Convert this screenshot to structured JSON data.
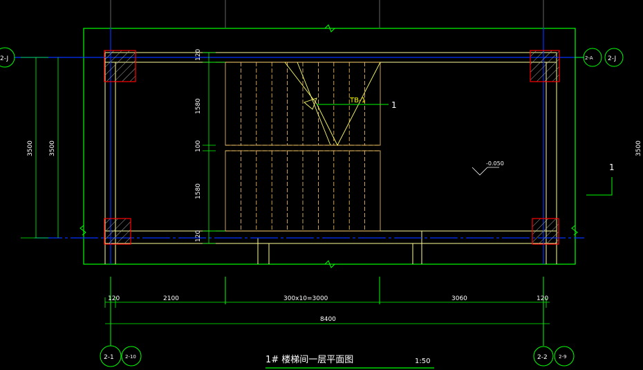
{
  "colors": {
    "background": "#000000",
    "outline": "#00ff00",
    "wall": "#ffff99",
    "axis": "#0000ff",
    "column": "#ff0000",
    "stair": "#ffcc66",
    "text": "#ffffff",
    "note": "#ffff00"
  },
  "axes": {
    "left_top": "2-J",
    "right_a": "2-A",
    "right_j": "2-J",
    "bottom_left_1": "2-1",
    "bottom_left_2": "2-10",
    "bottom_right_1": "2-2",
    "bottom_right_2": "2-9"
  },
  "vertical_dims": {
    "top_wall": "120",
    "flight_upper": "1580",
    "landing": "100",
    "flight_lower": "1580",
    "bottom_wall": "120",
    "total_a": "3500",
    "total_b": "3500",
    "right_total": "3500"
  },
  "horizontal_dims": {
    "left_wall": "120",
    "left_span": "2100",
    "stair_run": "300x10=3000",
    "right_span": "3060",
    "right_wall": "120",
    "overall": "8400"
  },
  "labels": {
    "stair_tag": "TB-1",
    "section_mark": "1",
    "section_mark_right": "1",
    "elevation": "-0.050"
  },
  "title": {
    "main": "1# 楼梯间一层平面图",
    "scale": "1:50"
  }
}
